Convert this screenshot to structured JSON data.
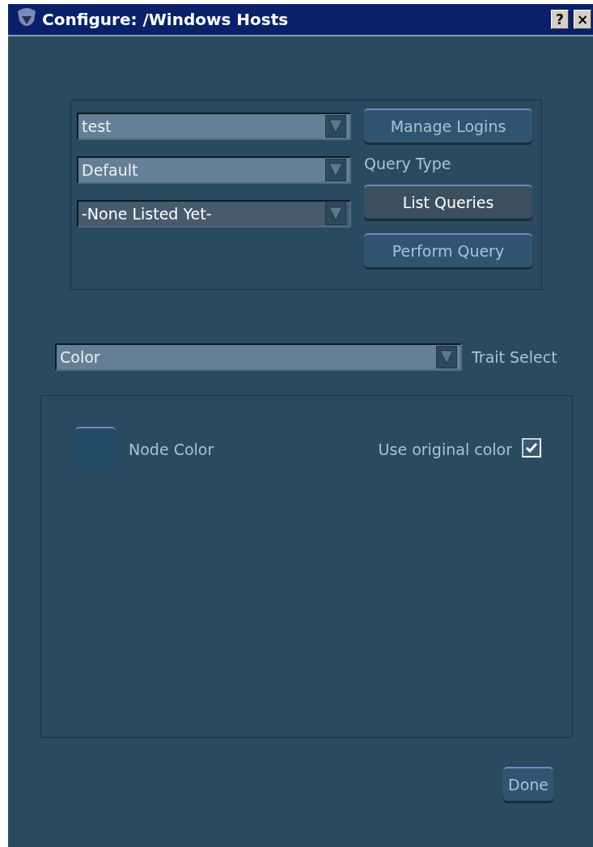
{
  "window": {
    "title": "Configure: /Windows Hosts",
    "title_buttons": [
      "?",
      "×"
    ]
  },
  "query_panel": {
    "dropdowns": [
      {
        "value": "test",
        "disabled": false
      },
      {
        "value": "Default",
        "disabled": false
      },
      {
        "value": "-None Listed Yet-",
        "disabled": true
      }
    ],
    "side": [
      {
        "kind": "button",
        "label": "Manage Logins",
        "highlighted": false
      },
      {
        "kind": "label",
        "label": "Query Type"
      },
      {
        "kind": "button",
        "label": "List Queries",
        "highlighted": true
      },
      {
        "kind": "button",
        "label": "Perform Query",
        "highlighted": false
      }
    ]
  },
  "trait_select": {
    "value": "Color",
    "label": "Trait Select"
  },
  "trait_panel": {
    "node_color_label": "Node Color",
    "use_original": {
      "label": "Use original color",
      "checked": true
    }
  },
  "done_button": "Done"
}
